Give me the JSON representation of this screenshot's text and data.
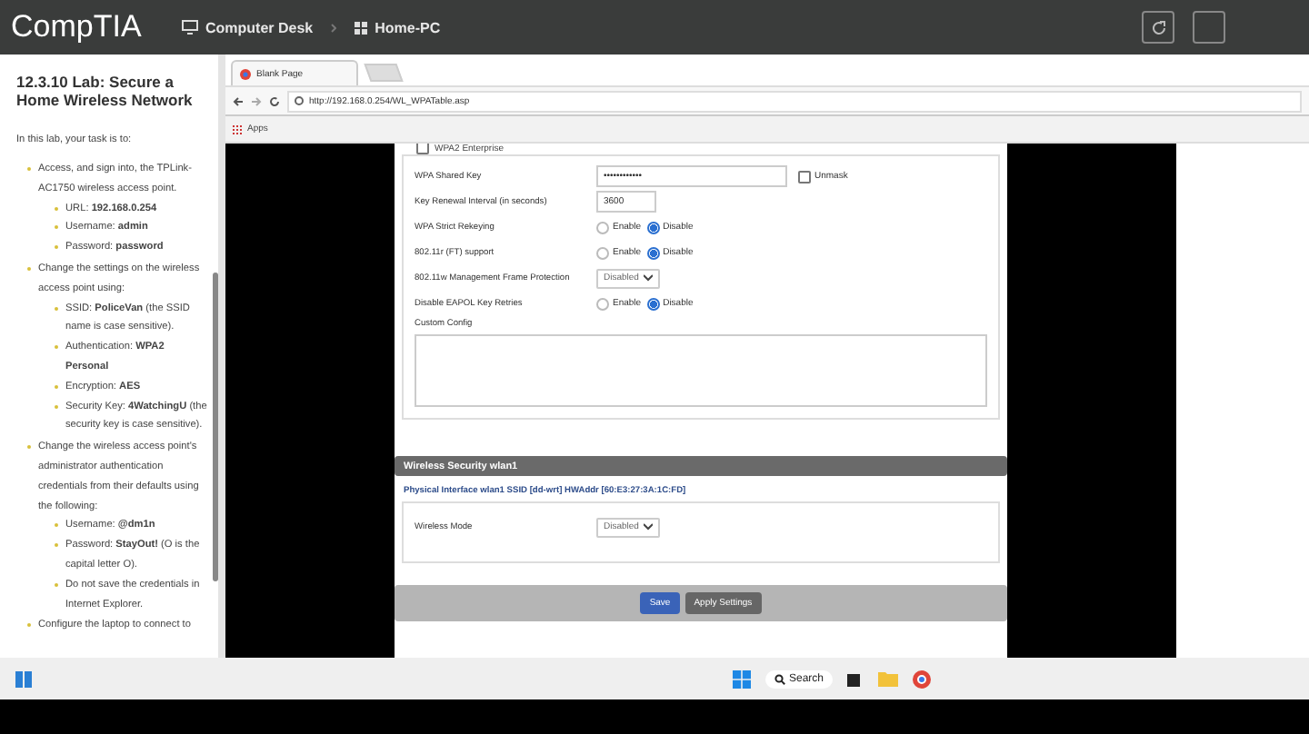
{
  "topbar": {
    "logo": "CompTIA",
    "breadcrumbs": [
      {
        "kind": "desk",
        "label": "Computer Desk"
      },
      {
        "kind": "pc",
        "label": "Home-PC"
      }
    ]
  },
  "instructions": {
    "title": "12.3.10 Lab: Secure a Home Wireless Network",
    "intro": "In this lab, your task is to:",
    "items": [
      {
        "text": "Access, and sign into, the TPLink-AC1750 wireless access point.",
        "children": [
          {
            "text": "URL: **192.168.0.254**"
          },
          {
            "text": "Username: **admin**"
          },
          {
            "text": "Password: **password**"
          }
        ]
      },
      {
        "text": "Change the settings on the wireless access point using:",
        "children": [
          {
            "text": "SSID: **PoliceVan** (the SSID name is case sensitive)."
          },
          {
            "text": "Authentication: **WPA2 Personal**"
          },
          {
            "text": "Encryption: **AES**"
          },
          {
            "text": "Security Key: **4WatchingU** (the security key is case sensitive)."
          }
        ]
      },
      {
        "text": "Change the wireless access point's administrator authentication credentials from their defaults using the following:",
        "children": [
          {
            "text": "Username: **@dm1n**"
          },
          {
            "text": "Password: **StayOut!** (O is the capital letter O)."
          },
          {
            "text": "Do not save the credentials in Internet Explorer."
          }
        ]
      },
      {
        "text": "Configure the laptop to connect to"
      }
    ]
  },
  "browser": {
    "tabs": [
      {
        "label": "Blank Page",
        "selected": true
      }
    ],
    "url": "http://192.168.0.254/WL_WPATable.asp",
    "bookmarks": [
      "Apps"
    ]
  },
  "page": {
    "partial_option": {
      "label": "WPA2 Enterprise",
      "checked": false
    },
    "fields": [
      {
        "kind": "password",
        "label": "WPA Shared Key",
        "value": "••••••••••••",
        "unmask": {
          "label": "Unmask",
          "checked": false
        }
      },
      {
        "kind": "text",
        "label": "Key Renewal Interval (in seconds)",
        "value": "3600"
      },
      {
        "kind": "radio",
        "label": "WPA Strict Rekeying",
        "options": [
          {
            "label": "Enable",
            "selected": false
          },
          {
            "label": "Disable",
            "selected": true
          }
        ]
      },
      {
        "kind": "radio",
        "label": "802.11r (FT) support",
        "options": [
          {
            "label": "Enable",
            "selected": false
          },
          {
            "label": "Disable",
            "selected": true
          }
        ]
      },
      {
        "kind": "select",
        "label": "802.11w Management Frame Protection",
        "value": "Disabled"
      },
      {
        "kind": "radio",
        "label": "Disable EAPOL Key Retries",
        "options": [
          {
            "label": "Enable",
            "selected": false
          },
          {
            "label": "Disable",
            "selected": true
          }
        ]
      },
      {
        "kind": "textarea",
        "label": "Custom Config"
      }
    ],
    "section": {
      "title": "Wireless Security wlan1",
      "legend": "Physical Interface wlan1 SSID [dd-wrt] HWAddr [60:E3:27:3A:1C:FD]",
      "fields": [
        {
          "kind": "select",
          "label": "Wireless Mode",
          "value": "Disabled"
        }
      ]
    },
    "buttons": [
      {
        "kind": "primary",
        "label": "Save"
      },
      {
        "kind": "secondary",
        "label": "Apply Settings"
      }
    ]
  },
  "taskbar": {
    "search": "Search"
  }
}
